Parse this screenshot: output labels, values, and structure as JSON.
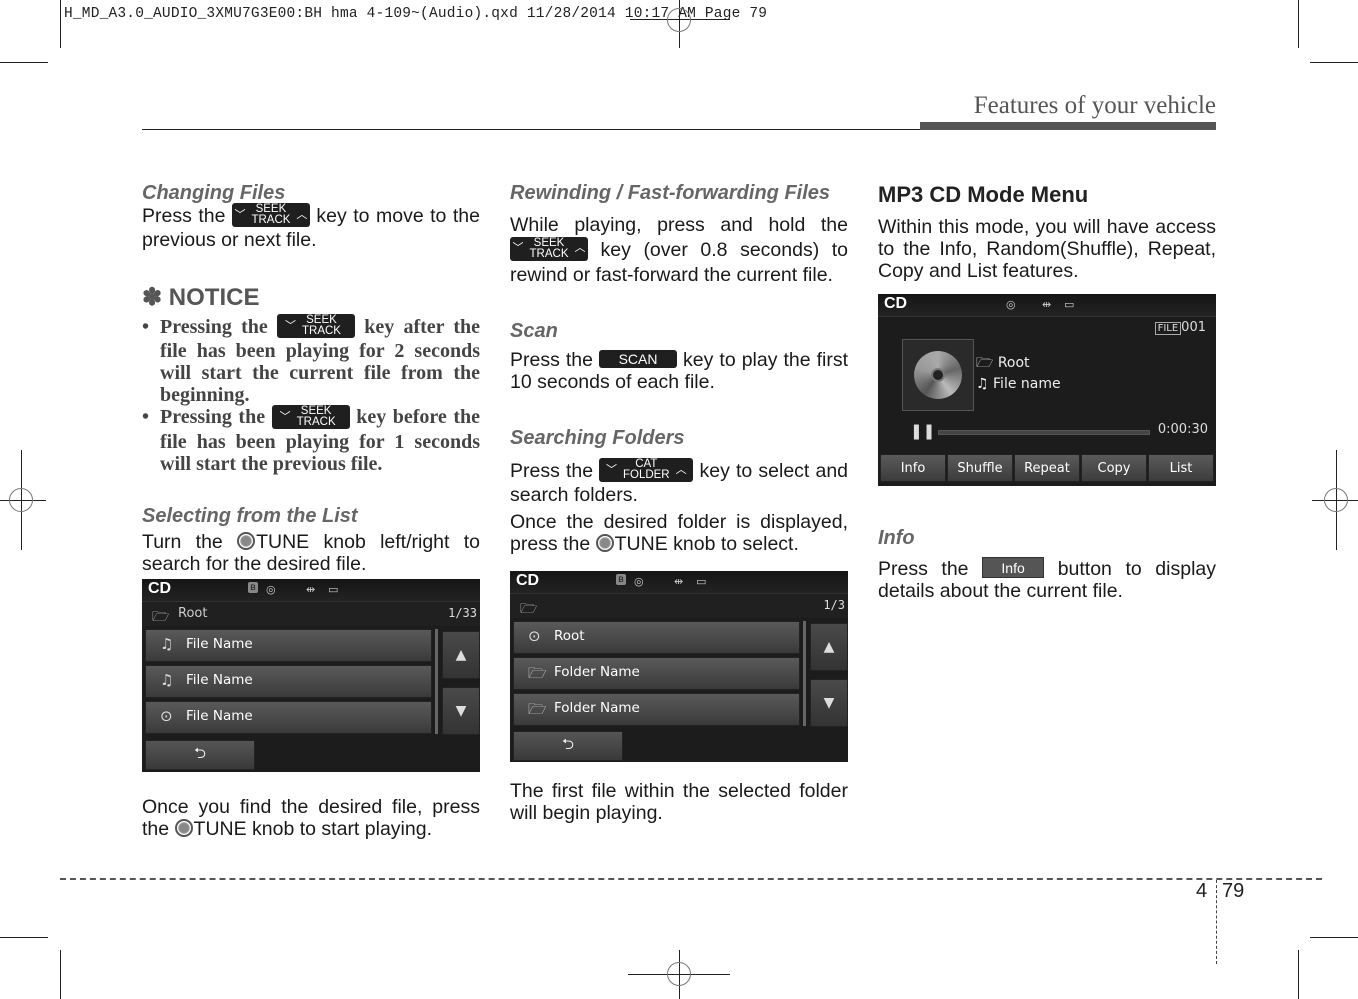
{
  "slug": "H_MD_A3.0_AUDIO_3XMU7G3E00:BH hma 4-109~(Audio).qxd  11/28/2014  10:17 AM  Page 79",
  "header": {
    "title": "Features of your vehicle"
  },
  "keys": {
    "seek_top": "SEEK",
    "seek_bottom": "TRACK",
    "cat_top": "CAT",
    "cat_bottom": "FOLDER",
    "scan": "SCAN",
    "info": "Info",
    "tune": "TUNE"
  },
  "col1": {
    "changing_title": "Changing Files",
    "changing_pre": "Press the",
    "changing_post": "key to move to the previous or next file.",
    "notice_title": "✽ NOTICE",
    "bullet1_pre": "Pressing the",
    "bullet1_post": "key after the file has been playing for 2 seconds will start the current file from the beginning.",
    "bullet2_pre": "Pressing the",
    "bullet2_post": "key before the file has been playing for 1 seconds will start the previous file.",
    "selecting_title": "Selecting from the List",
    "selecting_pre": "Turn the",
    "selecting_post": "knob left/right to search for the desired file.",
    "after_pre": "Once you find the desired file, press the",
    "after_post": "knob to start playing."
  },
  "col2": {
    "rewind_title": "Rewinding / Fast-forwarding Files",
    "rewind_pre": "While playing, press and hold the",
    "rewind_post": "key (over 0.8 seconds) to rewind or fast-forward the current file.",
    "scan_title": "Scan",
    "scan_pre": "Press the",
    "scan_post": "key to play the first 10 seconds of each file.",
    "folders_title": "Searching Folders",
    "folders_pre": "Press the",
    "folders_post": "key to select and search folders.",
    "folders2_pre": "Once the desired folder is displayed, press the",
    "folders2_post": "knob to select.",
    "after": "The first file within the selected folder will begin playing."
  },
  "col3": {
    "menu_title": "MP3 CD Mode Menu",
    "menu_body": "Within this mode, you will have access to the Info, Random(Shuffle), Repeat, Copy and List features.",
    "info_title": "Info",
    "info_pre": "Press the",
    "info_post": "button to display details about the current file."
  },
  "screen1": {
    "mode": "CD",
    "path": "Root",
    "count": "1/33",
    "rows": [
      {
        "icon": "music-note",
        "label": "File Name"
      },
      {
        "icon": "music-note",
        "label": "File Name"
      },
      {
        "icon": "play",
        "label": "File Name"
      }
    ]
  },
  "screen2": {
    "mode": "CD",
    "path": "",
    "count": "1/3",
    "rows": [
      {
        "icon": "play",
        "label": "Root"
      },
      {
        "icon": "folder",
        "label": "Folder Name"
      },
      {
        "icon": "folder",
        "label": "Folder Name"
      }
    ]
  },
  "screen3": {
    "mode": "CD",
    "file_badge": "FILE",
    "file_number": "001",
    "folder": "Root",
    "file": "File name",
    "elapsed": "0:00:30",
    "progress": 0.0,
    "buttons": [
      "Info",
      "Shuffle",
      "Repeat",
      "Copy",
      "List"
    ]
  },
  "footer": {
    "section": "4",
    "page": "79"
  }
}
